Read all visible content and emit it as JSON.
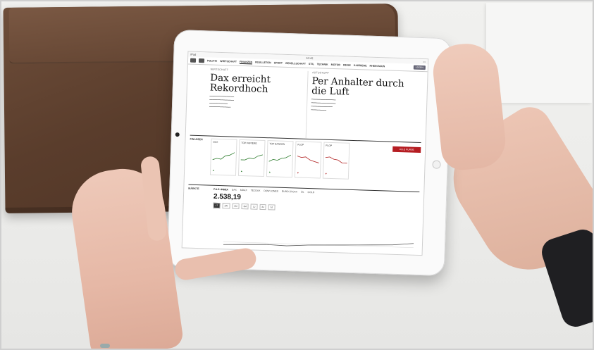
{
  "status_bar": {
    "carrier": "iPad",
    "time": "10:42"
  },
  "nav": {
    "items": [
      "POLITIK",
      "WIRTSCHAFT",
      "FINANZEN",
      "FEUILLETON",
      "SPORT",
      "GESELLSCHAFT",
      "STIL",
      "TECHNIK",
      "MOTOR",
      "REISE",
      "KARRIERE",
      "RHEIN-MAIN"
    ],
    "active": "FINANZEN",
    "login": "LOGIN"
  },
  "articles": [
    {
      "kicker": "WIRTSCHAFT",
      "headline": "Dax erreicht Rekordhoch"
    },
    {
      "kicker": "AUTOSTOPP",
      "headline": "Per Anhalter durch die Luft"
    }
  ],
  "finance": {
    "title": "FINANZEN",
    "cards": [
      {
        "label": "DAX",
        "trend": "up"
      },
      {
        "label": "TOP PAPIERE",
        "trend": "up"
      },
      {
        "label": "TOP BANKEN",
        "trend": "up"
      },
      {
        "label": "FLOP",
        "trend": "down"
      },
      {
        "label": "FLOP",
        "trend": "down"
      }
    ],
    "side_button": "ALLE KURSE"
  },
  "market": {
    "title": "MÄRKTE",
    "tabs": [
      "F.A.Z.-INDEX",
      "DAX",
      "MDAX",
      "TECDAX",
      "DOW JONES",
      "EURO STOXX",
      "ÖL",
      "GOLD"
    ],
    "index_value": "2.538,19",
    "ranges": [
      "1T",
      "1W",
      "1M",
      "3M",
      "1J",
      "3J",
      "5J"
    ]
  }
}
